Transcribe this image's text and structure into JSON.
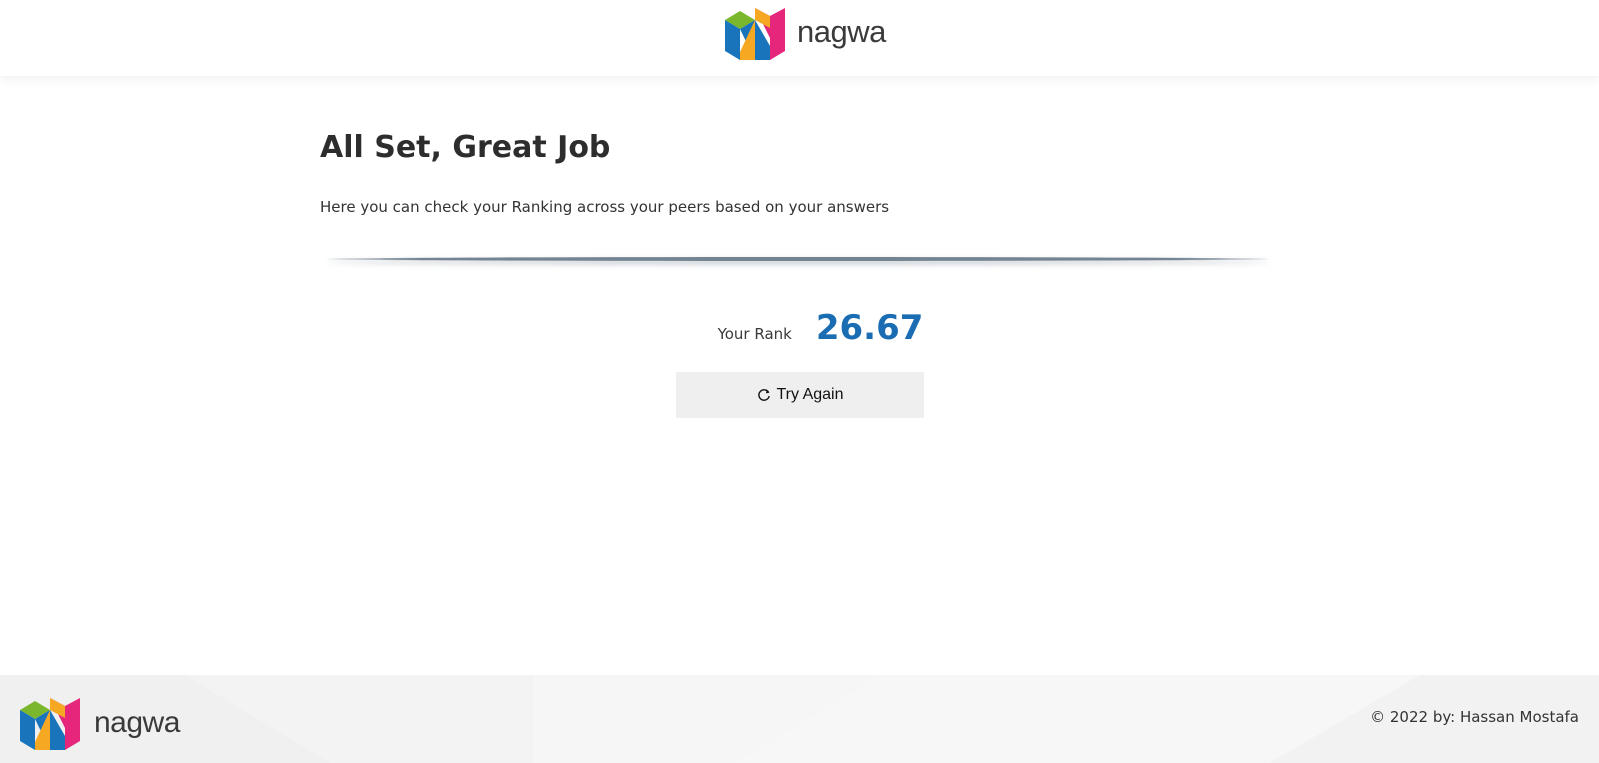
{
  "header": {
    "brand_name": "nagwa",
    "logo_icon": "nagwa-logo-icon"
  },
  "main": {
    "title": "All Set, Great Job",
    "subtitle": "Here you can check your Ranking across your peers based on your answers",
    "rank_label": "Your Rank",
    "rank_value": "26.67",
    "try_again_label": "Try Again",
    "try_again_icon": "refresh-icon"
  },
  "footer": {
    "brand_name": "nagwa",
    "copyright": "© 2022 by: Hassan Mostafa"
  },
  "colors": {
    "accent_blue": "#1b6db3",
    "logo_blue": "#1a74bb",
    "logo_pink": "#e5267b",
    "logo_green": "#7bb72d",
    "logo_orange": "#f7a823",
    "button_bg": "#efefef",
    "footer_bg": "#f2f2f2"
  }
}
